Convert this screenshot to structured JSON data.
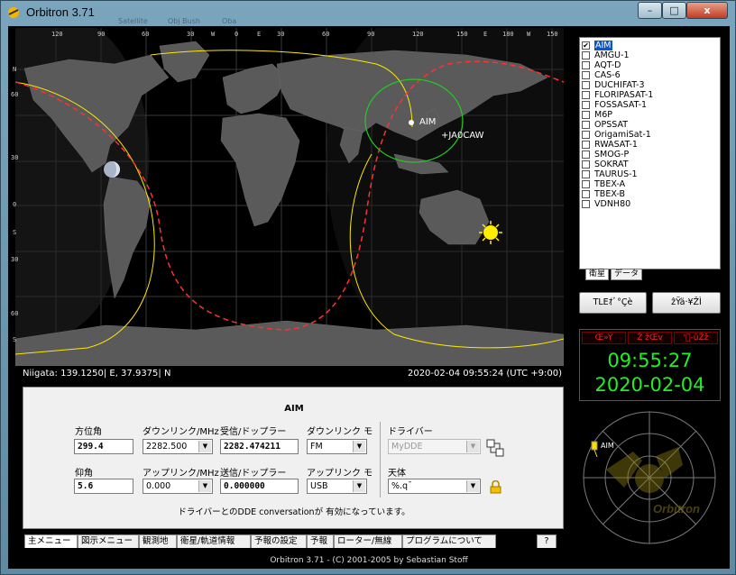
{
  "window": {
    "title": "Orbitron 3.71",
    "min": "–",
    "max": "□",
    "close": "x",
    "ghost_labels": [
      "Satellite",
      "Obj Bush",
      "Oba"
    ]
  },
  "map": {
    "top_ticks": [
      "120",
      "90",
      "60",
      "30",
      "W",
      "0",
      "E",
      "30",
      "60",
      "90",
      "120",
      "150",
      "E",
      "180",
      "W",
      "150"
    ],
    "left_ticks": [
      "N",
      "60",
      "30",
      "0",
      "S",
      "30",
      "60",
      "S"
    ],
    "location": "Niigata: 139.1250| E, 37.9375| N",
    "datetime": "2020-02-04 09:55:24 (UTC +9:00)",
    "sat_label": "AIM",
    "station_label": "+JA0CAW"
  },
  "panel": {
    "title": "AIM",
    "labels": {
      "azimuth": "方位角",
      "downlink": "ダウンリンク/MHz",
      "rx_doppler": "受信/ドップラー",
      "downlink_mode": "ダウンリンク モ",
      "driver": "ドライバー",
      "elevation": "仰角",
      "uplink": "アップリンク/MHz",
      "tx_doppler": "送信/ドップラー",
      "uplink_mode": "アップリンク モ",
      "object": "天体"
    },
    "values": {
      "azimuth": "299.4",
      "downlink": "2282.500",
      "rx_doppler": "2282.474211",
      "downlink_mode": "FM",
      "driver": "MyDDE",
      "elevation": "5.6",
      "uplink": "0.000",
      "tx_doppler": "0.000000",
      "uplink_mode": "USB",
      "object": "%.q¯"
    },
    "status": "ドライバーとのDDE conversationが 有効になっています。"
  },
  "tabs": [
    "主メニュー",
    "図示メニュー",
    "観測地",
    "衛星/軌道情報",
    "予報の設定",
    "予報",
    "ローター/無線",
    "プログラムについて",
    "?"
  ],
  "footer": "Orbitron 3.71 - (C) 2001-2005 by Sebastian Stoff",
  "satellites": [
    {
      "name": "AIM",
      "checked": true,
      "selected": true
    },
    {
      "name": "AMGU-1",
      "checked": false
    },
    {
      "name": "AQT-D",
      "checked": false
    },
    {
      "name": "CAS-6",
      "checked": false
    },
    {
      "name": "DUCHIFAT-3",
      "checked": false
    },
    {
      "name": "FLORIPASAT-1",
      "checked": false
    },
    {
      "name": "FOSSASAT-1",
      "checked": false
    },
    {
      "name": "M6P",
      "checked": false
    },
    {
      "name": "OPSSAT",
      "checked": false
    },
    {
      "name": "OrigamiSat-1",
      "checked": false
    },
    {
      "name": "RWASAT-1",
      "checked": false
    },
    {
      "name": "SMOG-P",
      "checked": false
    },
    {
      "name": "SOKRAT",
      "checked": false
    },
    {
      "name": "TAURUS-1",
      "checked": false
    },
    {
      "name": "TBEX-A",
      "checked": false
    },
    {
      "name": "TBEX-B",
      "checked": false
    },
    {
      "name": "VDNH80",
      "checked": false
    }
  ],
  "sat_tabs": [
    "衛星",
    "データ"
  ],
  "buttons": {
    "tle": "TLEｵﾞ°Çè",
    "other": "ẑŸä·¥ŽÌ"
  },
  "clock": {
    "headers": [
      "Œ»Ý",
      "Ž žŒv",
      "'ﾟ-ûŽž"
    ],
    "time": "09:55:27",
    "date": "2020-02-04"
  },
  "radar": {
    "label": "AIM",
    "watermark": "Orbitron"
  },
  "colors": {
    "clock_green": "#22ee22",
    "selection": "#0a58c8",
    "track_yellow": "#ffe800",
    "footprint_green": "#22cc22"
  }
}
